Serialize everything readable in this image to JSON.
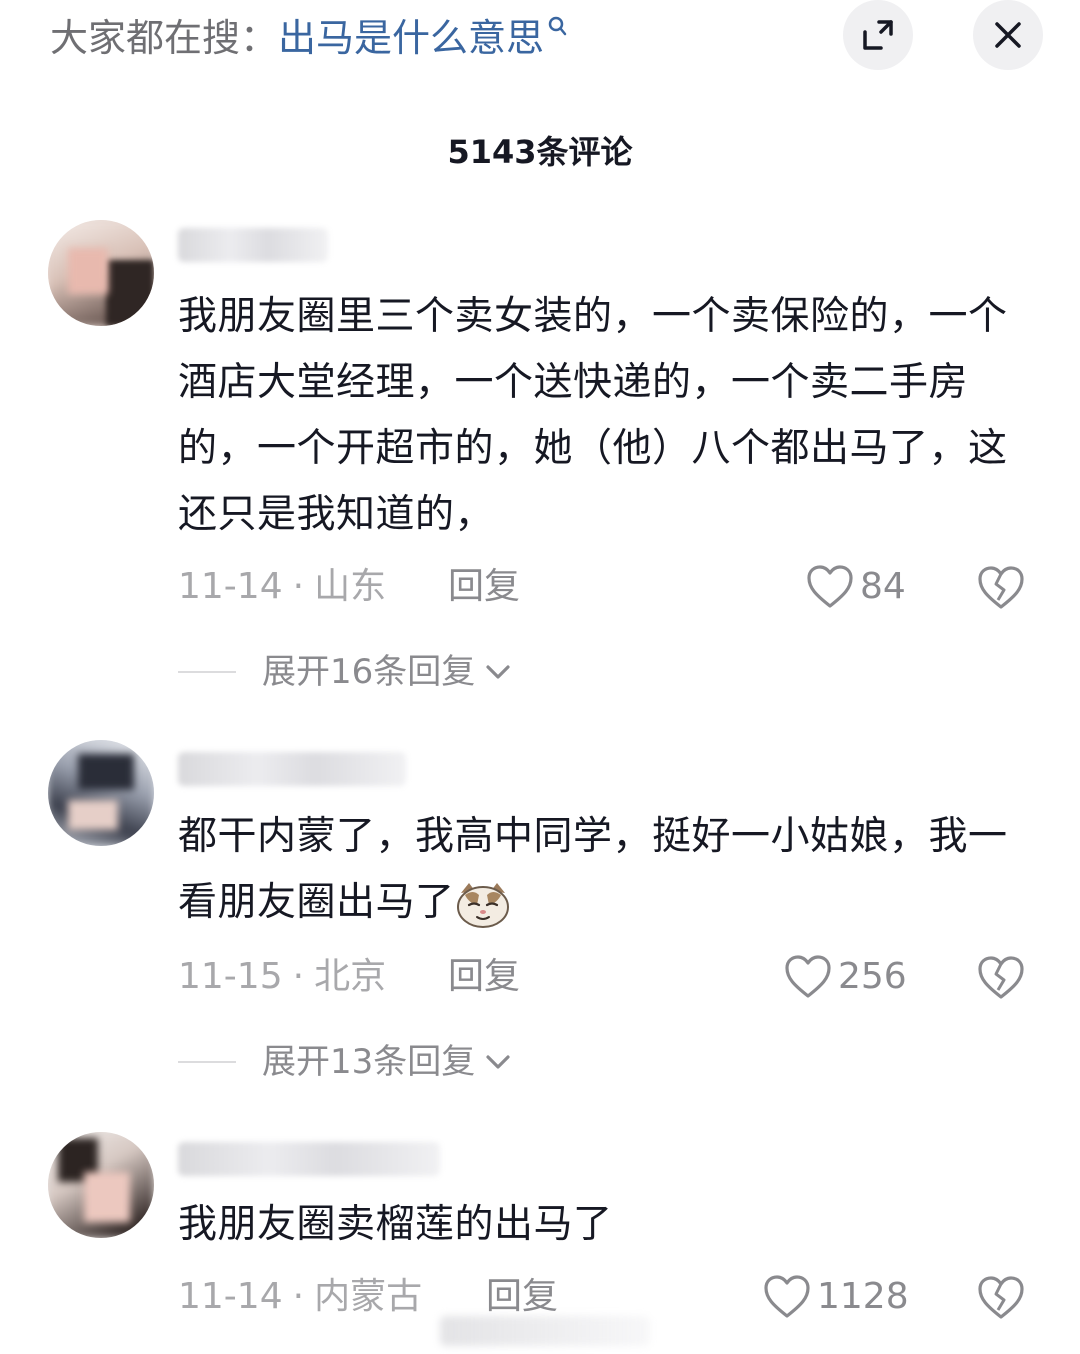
{
  "search_bar": {
    "prefix": "大家都在搜：",
    "query": "出马是什么意思"
  },
  "header": {
    "comment_count_label": "5143条评论"
  },
  "comments": [
    {
      "text": "我朋友圈里三个卖女装的，一个卖保险的，一个酒店大堂经理，一个送快递的，一个卖二手房的，一个开超市的，她（他）八个都出马了，这还只是我知道的，",
      "date": "11-14",
      "location": "山东",
      "reply_label": "回复",
      "likes": "84",
      "expand_label": "展开16条回复"
    },
    {
      "text": "都干内蒙了，我高中同学，挺好一小姑娘，我一看朋友圈出马了",
      "date": "11-15",
      "location": "北京",
      "reply_label": "回复",
      "likes": "256",
      "expand_label": "展开13条回复"
    },
    {
      "text": "我朋友圈卖榴莲的出马了",
      "date": "11-14",
      "location": "内蒙古",
      "reply_label": "回复",
      "likes": "1128"
    }
  ],
  "icons": {
    "search": "search-icon",
    "expand": "expand-icon",
    "close": "close-icon",
    "like": "heart-outline-icon",
    "dislike": "broken-heart-icon",
    "chevron": "chevron-down-icon",
    "emoji": "cat-smirk-emoji"
  },
  "colors": {
    "text_primary": "#161823",
    "text_secondary": "#8a8a8e",
    "meta": "#a8a8ab",
    "search_query": "#3a66a0"
  }
}
